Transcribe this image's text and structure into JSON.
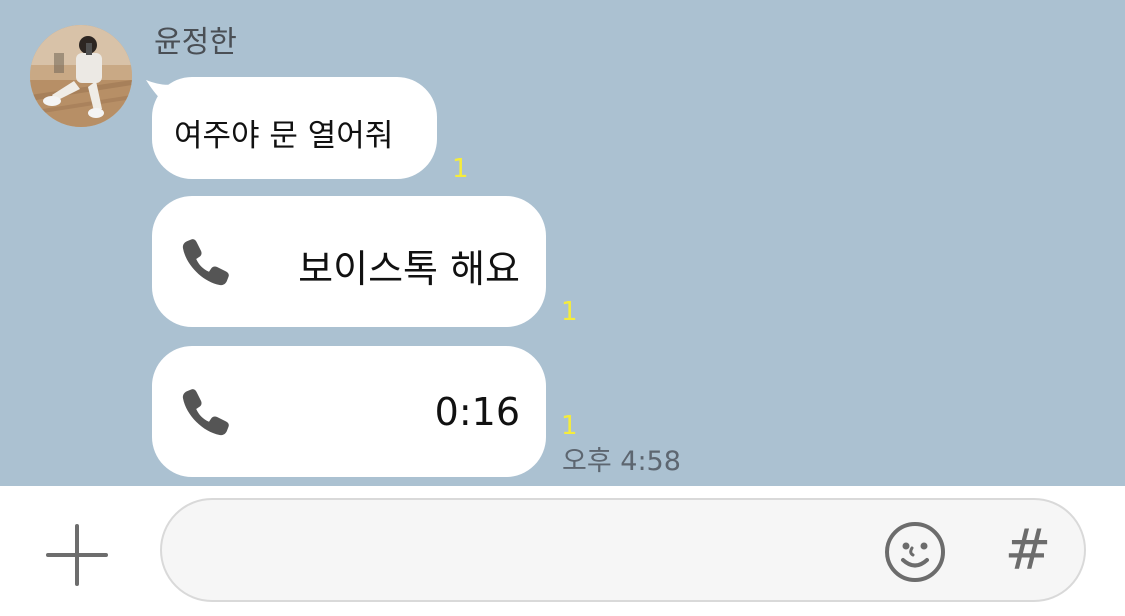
{
  "conversation": {
    "sender_name": "윤정한",
    "messages": [
      {
        "type": "text",
        "text": "여주야 문 열어줘",
        "unread": "1"
      },
      {
        "type": "voice-call",
        "text": "보이스톡 해요",
        "icon": "phone-icon",
        "unread": "1"
      },
      {
        "type": "voice-call",
        "text": "0:16",
        "icon": "phone-icon",
        "unread": "1",
        "time": "오후 4:58"
      }
    ]
  },
  "input_bar": {
    "plus_icon": "plus-icon",
    "message_value": "",
    "emoji_icon": "emoji-icon",
    "hash_label": "#"
  },
  "colors": {
    "chat_background": "#abc1d1",
    "bubble": "#ffffff",
    "unread_count": "#f5ec3c",
    "timestamp": "#5d6670"
  }
}
